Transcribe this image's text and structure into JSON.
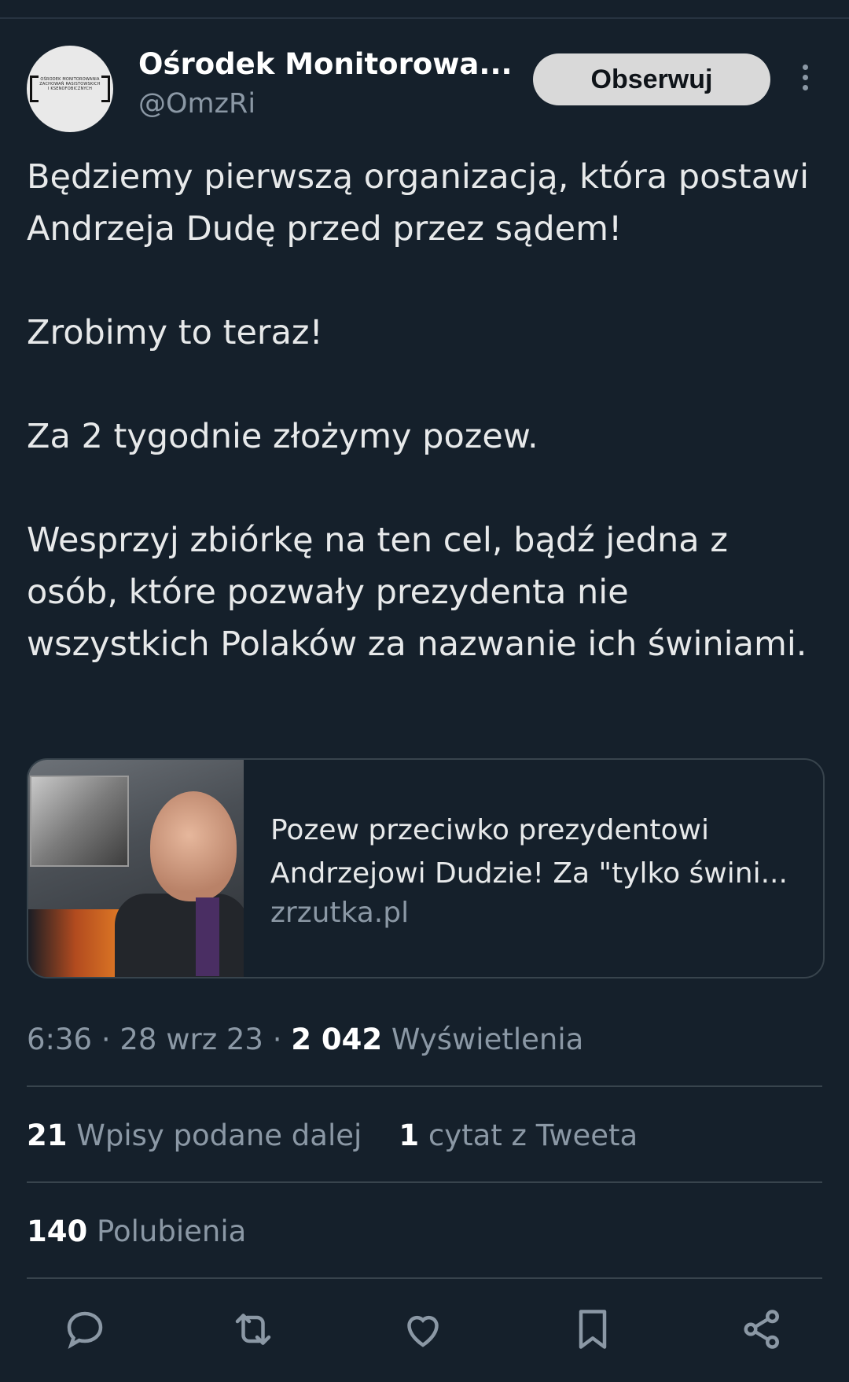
{
  "header": {
    "account_name": "Ośrodek Monitorowa...",
    "handle": "@OmzRi",
    "follow_label": "Obserwuj",
    "avatar_text": "OŚRODEK MONITOROWANIA ZACHOWAŃ RASISTOWSKICH I KSENOFOBICZNYCH"
  },
  "tweet": {
    "paragraphs": [
      "Będziemy pierwszą organizacją, która postawi Andrzeja Dudę przed przez sądem!",
      "Zrobimy to teraz!",
      "Za 2 tygodnie złożymy pozew.",
      "Wesprzyj zbiórkę na ten cel, bądź jedna z osób, które pozwały prezydenta nie wszystkich Polaków za nazwanie ich świniami."
    ]
  },
  "card": {
    "title_line1": "Pozew przeciwko prezydentowi",
    "title_line2": "Andrzejowi Dudzie! Za \"tylko świni...",
    "domain": "zrzutka.pl"
  },
  "meta": {
    "time": "6:36",
    "date": "28 wrz 23",
    "views_count": "2 042",
    "views_label": "Wyświetlenia"
  },
  "stats": {
    "retweets_count": "21",
    "retweets_label": "Wpisy podane dalej",
    "quotes_count": "1",
    "quotes_label": "cytat z Tweeta",
    "likes_count": "140",
    "likes_label": "Polubienia"
  },
  "actions": [
    "reply-icon",
    "retweet-icon",
    "like-icon",
    "bookmark-icon",
    "share-icon"
  ],
  "colors": {
    "background": "#15202b",
    "text": "#e7e9ea",
    "muted": "#8b98a5",
    "divider": "#38444d",
    "follow_button": "#d9d9d9"
  }
}
